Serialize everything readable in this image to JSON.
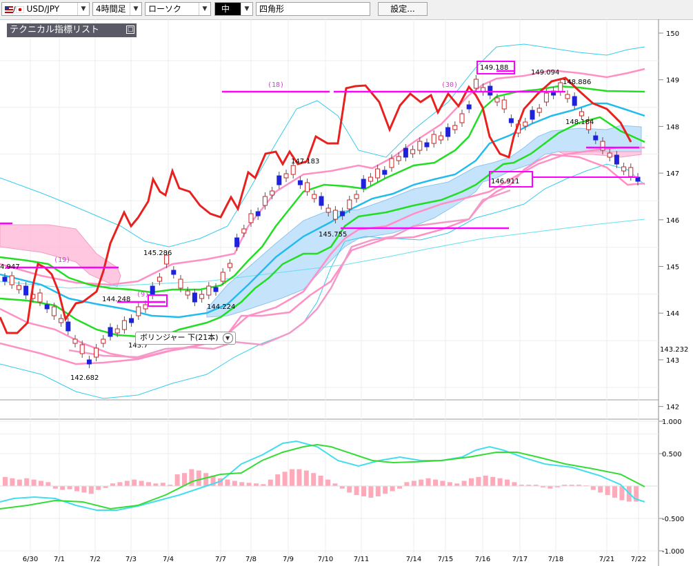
{
  "toolbar": {
    "symbol": "USD/JPY",
    "timeframe": "4時間足",
    "chart_type": "ローソク",
    "line_width": "中",
    "shape": "四角形",
    "settings": "設定..."
  },
  "indicator_list": {
    "title": "テクニカル指標リスト",
    "toggle": "□"
  },
  "tooltip": {
    "text": "ボリンジャー 下(21本)",
    "icon": "chevron-down-icon"
  },
  "colors": {
    "rsi": "#e8201e",
    "bb_mid": "#22bbee",
    "ichimoku_span": "#33dd33",
    "bb_band": "#ff99cc",
    "macd_hist": "#ffaabb",
    "magenta": "#ff00ff"
  },
  "chart_data": {
    "type": "candlestick",
    "price_axis": {
      "ticks": [
        "150",
        "149",
        "148",
        "147",
        "146",
        "145",
        "144",
        "143",
        "142"
      ],
      "current": "143.232",
      "range": [
        142,
        150
      ]
    },
    "osc_axis": {
      "ticks": [
        "1.000",
        "0.500",
        "-0.500",
        "-1.000"
      ],
      "range": [
        -1,
        1
      ]
    },
    "date_labels": [
      "6/30",
      "7/1",
      "7/2",
      "7/3",
      "7/4",
      "7/7",
      "7/8",
      "7/9",
      "7/10",
      "7/11",
      "7/14",
      "7/15",
      "7/16",
      "7/17",
      "7/18",
      "7/21",
      "7/22"
    ],
    "price_labels": [
      "4.947",
      "144.248",
      "145.286",
      "144.224",
      "142.682",
      "147.183",
      "145.755",
      "149.188",
      "149.094",
      "148.886",
      "148.184",
      "146.911",
      "143.7"
    ],
    "count_labels": [
      "(19)",
      "(9)",
      "(18)",
      "(30)"
    ]
  }
}
